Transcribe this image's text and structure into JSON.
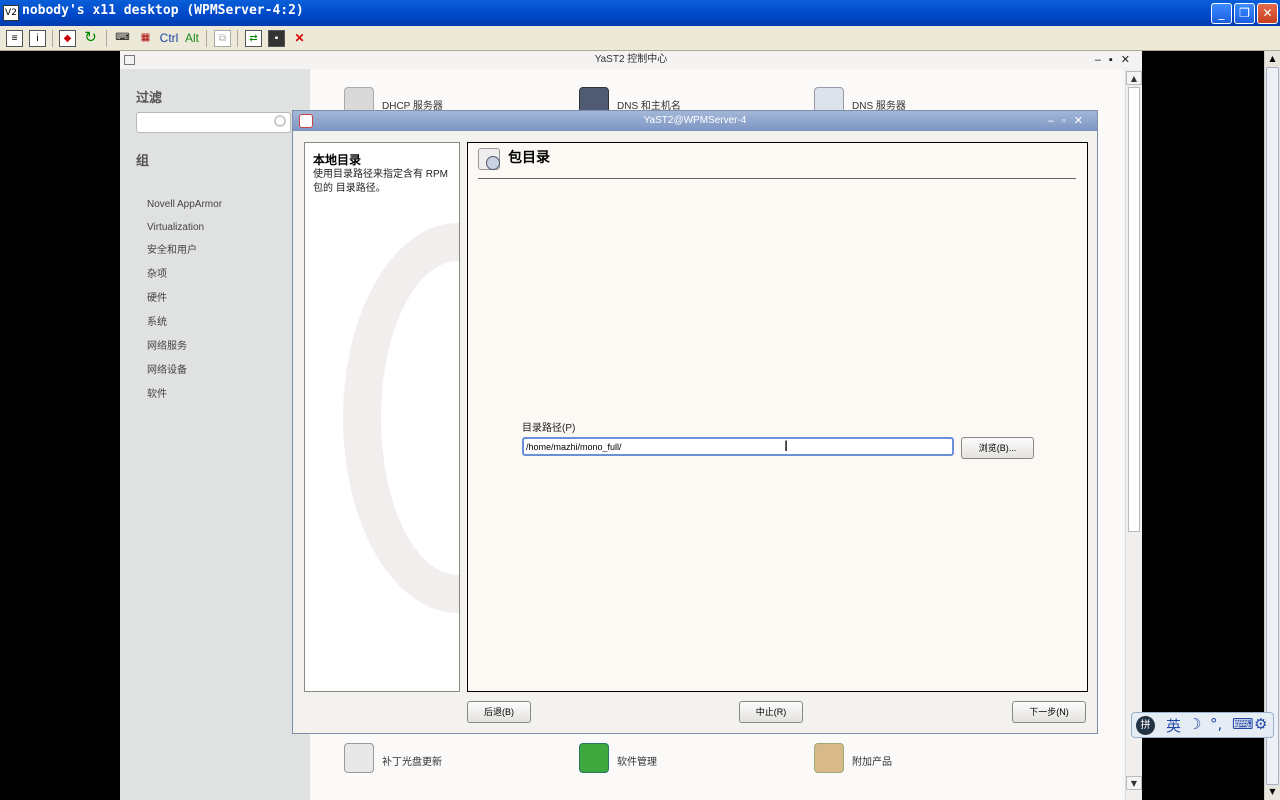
{
  "vnc": {
    "title": "nobody's x11 desktop (WPMServer-4:2)",
    "app_icon": "vnc-icon",
    "toolbar": {
      "ctrl_label": "Ctrl",
      "alt_label": "Alt"
    },
    "window_buttons": [
      "minimize",
      "restore",
      "close"
    ]
  },
  "yast": {
    "title": "YaST2 控制中心",
    "sidebar": {
      "filter_heading": "过滤",
      "filter_placeholder": "",
      "group_heading": "组",
      "items": [
        {
          "label": "Novell AppArmor"
        },
        {
          "label": "Virtualization"
        },
        {
          "label": "安全和用户"
        },
        {
          "label": "杂项"
        },
        {
          "label": "硬件"
        },
        {
          "label": "系统"
        },
        {
          "label": "网络服务"
        },
        {
          "label": "网络设备"
        },
        {
          "label": "软件"
        }
      ]
    },
    "top_modules": [
      {
        "label": "DHCP 服务器",
        "icon": "server-icon"
      },
      {
        "label": "DNS 和主机名",
        "icon": "dns-host-icon"
      },
      {
        "label": "DNS 服务器",
        "icon": "dns-server-icon"
      }
    ],
    "bottom_modules": [
      {
        "label": "补丁光盘更新",
        "icon": "patch-cd-icon"
      },
      {
        "label": "软件管理",
        "icon": "software-icon"
      },
      {
        "label": "附加产品",
        "icon": "addon-box-icon"
      }
    ]
  },
  "dialog": {
    "title": "YaST2@WPMServer-4",
    "help": {
      "heading": "本地目录",
      "text": "使用目录路径来指定含有 RPM 包的 目录路径。"
    },
    "header": "包目录",
    "path_label": "目录路径(P)",
    "path_value": "/home/mazhi/mono_full/",
    "browse_label": "浏览(B)...",
    "back_label": "后退(B)",
    "abort_label": "中止(R)",
    "next_label": "下一步(N)"
  },
  "ime": {
    "mode_label": "英"
  },
  "colors": {
    "vnc_titlebar": "#0047c8",
    "dialog_titlebar": "#8ea3cc",
    "input_focus": "#6b8fd8"
  }
}
